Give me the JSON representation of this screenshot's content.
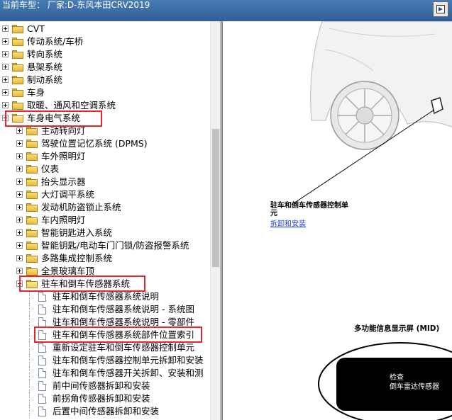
{
  "window": {
    "title": "当前车型：  厂家:D-东风本田CRV2019"
  },
  "tree": {
    "items": [
      {
        "label": "CVT",
        "type": "folder",
        "state": "collapsed"
      },
      {
        "label": "传动系统/车桥",
        "type": "folder",
        "state": "collapsed"
      },
      {
        "label": "转向系统",
        "type": "folder",
        "state": "collapsed"
      },
      {
        "label": "悬架系统",
        "type": "folder",
        "state": "collapsed"
      },
      {
        "label": "制动系统",
        "type": "folder",
        "state": "collapsed"
      },
      {
        "label": "车身",
        "type": "folder",
        "state": "collapsed"
      },
      {
        "label": "取暖、通风和空调系统",
        "type": "folder",
        "state": "collapsed"
      },
      {
        "label": "车身电气系统",
        "type": "folder",
        "state": "expanded",
        "highlighted": true
      },
      {
        "label": "主动转向灯",
        "type": "folder",
        "state": "collapsed"
      },
      {
        "label": "驾驶位置记忆系统 (DPMS)",
        "type": "folder",
        "state": "collapsed"
      },
      {
        "label": "车外照明灯",
        "type": "folder",
        "state": "collapsed"
      },
      {
        "label": "仪表",
        "type": "folder",
        "state": "collapsed"
      },
      {
        "label": "抬头显示器",
        "type": "folder",
        "state": "collapsed"
      },
      {
        "label": "大灯调平系统",
        "type": "folder",
        "state": "collapsed"
      },
      {
        "label": "发动机防盗锁止系统",
        "type": "folder",
        "state": "collapsed"
      },
      {
        "label": "车内照明灯",
        "type": "folder",
        "state": "collapsed"
      },
      {
        "label": "智能钥匙进入系统",
        "type": "folder",
        "state": "collapsed"
      },
      {
        "label": "智能钥匙/电动车门门锁/防盗报警系统",
        "type": "folder",
        "state": "collapsed"
      },
      {
        "label": "多路集成控制系统",
        "type": "folder",
        "state": "collapsed"
      },
      {
        "label": "全景玻璃车顶",
        "type": "folder",
        "state": "collapsed"
      },
      {
        "label": "驻车和倒车传感器系统",
        "type": "folder",
        "state": "expanded",
        "highlighted": true
      },
      {
        "label": "驻车和倒车传感器系统说明",
        "type": "doc"
      },
      {
        "label": "驻车和倒车传感器系统说明 - 系统图",
        "type": "doc"
      },
      {
        "label": "驻车和倒车传感器系统说明 - 零部件",
        "type": "doc"
      },
      {
        "label": "驻车和倒车传感器系统部件位置索引",
        "type": "doc",
        "highlighted": true
      },
      {
        "label": "重新设定驻车和倒车传感器控制单元",
        "type": "doc"
      },
      {
        "label": "驻车和倒车传感器控制单元拆卸和安装",
        "type": "doc"
      },
      {
        "label": "驻车和倒车传感器开关拆卸、安装和测",
        "type": "doc"
      },
      {
        "label": "前中间传感器拆卸和安装",
        "type": "doc"
      },
      {
        "label": "前拐角传感器拆卸和安装",
        "type": "doc"
      },
      {
        "label": "后置中间传感器拆卸和安装",
        "type": "doc"
      }
    ]
  },
  "content": {
    "callout_title": "驻车和倒车传感器控制单元",
    "callout_link": "拆卸和安装",
    "mid_title": "多功能信息显示屏 (MID)",
    "mid_screen_line1": "检查",
    "mid_screen_line2": "倒车雷达传感器"
  },
  "colors": {
    "titlebar": "#2f5f95",
    "highlight": "#e8262a",
    "link": "#1a3fd0"
  }
}
